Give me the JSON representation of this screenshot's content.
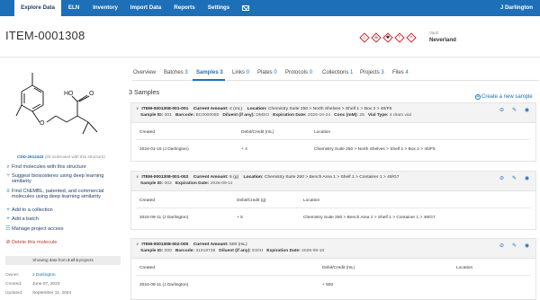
{
  "nav": {
    "items": [
      "Explore Data",
      "ELN",
      "Inventory",
      "Import Data",
      "Reports",
      "Settings"
    ],
    "mail_icon": "mail-icon",
    "user": "J Darlington"
  },
  "header": {
    "title": "ITEM-0001308",
    "hazards": [
      "flame-icon",
      "skull-icon",
      "health-hazard-icon",
      "exclamation-icon",
      "environment-icon"
    ],
    "vault_label": "Vault",
    "vault_value": "Neverland"
  },
  "structure": {
    "id": "CDD-2612443",
    "note": "(26 molecules with this structure)",
    "atoms": [
      "HO",
      "O",
      "O"
    ]
  },
  "actions": [
    {
      "icon": "search-icon",
      "label": "Find molecules with this structure"
    },
    {
      "icon": "branch-icon",
      "label": "Suggest bioisosteres using deep learning similarity"
    },
    {
      "icon": "database-icon",
      "label": "Find ChEMBL, patented, and commercial molecules using deep learning similarity"
    },
    {
      "icon": "plus-icon",
      "label": "Add to a collection"
    },
    {
      "icon": "plus-icon",
      "label": "Add a batch"
    },
    {
      "icon": "people-icon",
      "label": "Manage project access"
    },
    {
      "icon": "delete-icon",
      "label": "Delete this molecule"
    }
  ],
  "projects_box": {
    "prefix": "Showing data from",
    "shown": "3 of 3",
    "suffix": "projects"
  },
  "meta": [
    {
      "key": "Owner:",
      "value": "J Darlington",
      "link": true
    },
    {
      "key": "Created:",
      "value": "June 07, 2023",
      "link": false
    },
    {
      "key": "Updated:",
      "value": "September 11, 2024",
      "link": false
    }
  ],
  "tabs": [
    {
      "label": "Overview",
      "count": ""
    },
    {
      "label": "Batches",
      "count": "3"
    },
    {
      "label": "Samples",
      "count": "3"
    },
    {
      "label": "Links",
      "count": "0"
    },
    {
      "label": "Plates",
      "count": "0"
    },
    {
      "label": "Protocols",
      "count": "0"
    },
    {
      "label": "Collections",
      "count": "1"
    },
    {
      "label": "Projects",
      "count": "3"
    },
    {
      "label": "Files",
      "count": "4"
    }
  ],
  "samples_heading": "3 Samples",
  "create_sample": "Create a new sample",
  "samples": [
    {
      "name": "ITEM-0001308-001-001",
      "amount_label": "Current Amount:",
      "amount": "4 (mL)",
      "location_label": "Location:",
      "location": "Chemistry Suite 250 > North Shelves > Shelf 1 > Box 2 > 40/F5",
      "details": [
        {
          "k": "Sample ID:",
          "v": "001"
        },
        {
          "k": "Barcode:",
          "v": "BC0000080"
        },
        {
          "k": "Diluent (if any):",
          "v": "DMSO"
        },
        {
          "k": "Expiration Date:",
          "v": "2026-10-24"
        },
        {
          "k": "Conc (mM):",
          "v": "25"
        },
        {
          "k": "Vial Type:",
          "v": "4 dram vial"
        }
      ],
      "columns": [
        "Created",
        "Debit/Credit (mL)",
        "Location"
      ],
      "rows": [
        [
          "2024-01-15 (J Darlington)",
          "+ 4",
          "Chemistry Suite 250 > North Shelves > Shelf 1 > Box 2 > 40/F5"
        ]
      ]
    },
    {
      "name": "ITEM-0001308-001-002",
      "amount_label": "Current Amount:",
      "amount": "5 (g)",
      "location_label": "Location:",
      "location": "Chemistry Suite 250 > Bench Area 1 > Shelf 1 > Container 1 > 49/G7",
      "details": [
        {
          "k": "Sample ID:",
          "v": "002"
        },
        {
          "k": "Expiration Date:",
          "v": "2026-09-11"
        }
      ],
      "columns": [
        "Created",
        "Debit/Credit (g)",
        "Location"
      ],
      "rows": [
        [
          "2024-09-11 (J Darlington)",
          "+ 5",
          "Chemistry Suite 250 > Bench Area 1 > Shelf 1 > Container 1 > 49/G7"
        ]
      ]
    },
    {
      "name": "ITEM-0001308-002-000",
      "amount_label": "Current Amount:",
      "amount": "500 (mL)",
      "location_label": "",
      "location": "",
      "details": [
        {
          "k": "Sample ID:",
          "v": "000"
        },
        {
          "k": "Barcode:",
          "v": "31918738"
        },
        {
          "k": "Diluent (if any):",
          "v": "EtOH"
        },
        {
          "k": "Expiration Date:",
          "v": "2026-09-10"
        }
      ],
      "columns": [
        "Created",
        "Debit/Credit (mL)",
        "Location"
      ],
      "rows": [
        [
          "2024-09-11 (J Darlington)",
          "+ 500",
          ""
        ]
      ]
    }
  ],
  "card_icons": [
    "hide-icon",
    "edit-icon",
    "view-icon"
  ]
}
